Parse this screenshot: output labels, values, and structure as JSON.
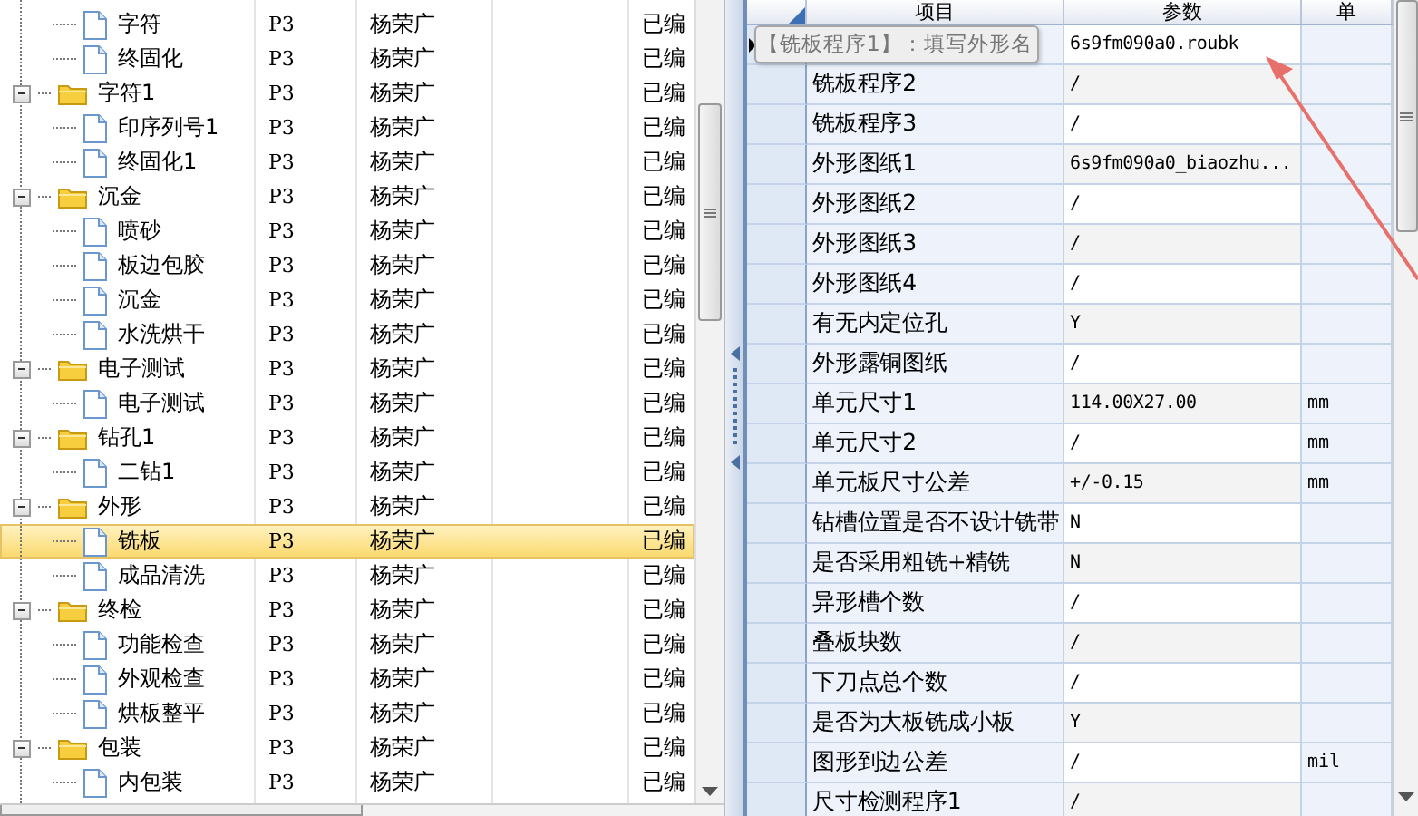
{
  "tree": [
    {
      "children": [
        {
          "kind": "file",
          "label": "字符",
          "ver": "P3",
          "person": "杨荣广",
          "status": "已编",
          "selected": false
        },
        {
          "kind": "file",
          "label": "终固化",
          "ver": "P3",
          "person": "杨荣广",
          "status": "已编",
          "selected": false
        }
      ]
    },
    {
      "kind": "folder",
      "label": "字符1",
      "ver": "P3",
      "person": "杨荣广",
      "status": "已编",
      "selected": false,
      "expanded": true,
      "children": [
        {
          "kind": "file",
          "label": "印序列号1",
          "ver": "P3",
          "person": "杨荣广",
          "status": "已编",
          "selected": false
        },
        {
          "kind": "file",
          "label": "终固化1",
          "ver": "P3",
          "person": "杨荣广",
          "status": "已编",
          "selected": false
        }
      ]
    },
    {
      "kind": "folder",
      "label": "沉金",
      "ver": "P3",
      "person": "杨荣广",
      "status": "已编",
      "selected": false,
      "expanded": true,
      "children": [
        {
          "kind": "file",
          "label": "喷砂",
          "ver": "P3",
          "person": "杨荣广",
          "status": "已编",
          "selected": false
        },
        {
          "kind": "file",
          "label": "板边包胶",
          "ver": "P3",
          "person": "杨荣广",
          "status": "已编",
          "selected": false
        },
        {
          "kind": "file",
          "label": "沉金",
          "ver": "P3",
          "person": "杨荣广",
          "status": "已编",
          "selected": false
        },
        {
          "kind": "file",
          "label": "水洗烘干",
          "ver": "P3",
          "person": "杨荣广",
          "status": "已编",
          "selected": false
        }
      ]
    },
    {
      "kind": "folder",
      "label": "电子测试",
      "ver": "P3",
      "person": "杨荣广",
      "status": "已编",
      "selected": false,
      "expanded": true,
      "children": [
        {
          "kind": "file",
          "label": "电子测试",
          "ver": "P3",
          "person": "杨荣广",
          "status": "已编",
          "selected": false
        }
      ]
    },
    {
      "kind": "folder",
      "label": "钻孔1",
      "ver": "P3",
      "person": "杨荣广",
      "status": "已编",
      "selected": false,
      "expanded": true,
      "children": [
        {
          "kind": "file",
          "label": "二钻1",
          "ver": "P3",
          "person": "杨荣广",
          "status": "已编",
          "selected": false
        }
      ]
    },
    {
      "kind": "folder",
      "label": "外形",
      "ver": "P3",
      "person": "杨荣广",
      "status": "已编",
      "selected": false,
      "expanded": true,
      "children": [
        {
          "kind": "file",
          "label": "铣板",
          "ver": "P3",
          "person": "杨荣广",
          "status": "已编",
          "selected": true
        },
        {
          "kind": "file",
          "label": "成品清洗",
          "ver": "P3",
          "person": "杨荣广",
          "status": "已编",
          "selected": false
        }
      ]
    },
    {
      "kind": "folder",
      "label": "终检",
      "ver": "P3",
      "person": "杨荣广",
      "status": "已编",
      "selected": false,
      "expanded": true,
      "children": [
        {
          "kind": "file",
          "label": "功能检查",
          "ver": "P3",
          "person": "杨荣广",
          "status": "已编",
          "selected": false
        },
        {
          "kind": "file",
          "label": "外观检查",
          "ver": "P3",
          "person": "杨荣广",
          "status": "已编",
          "selected": false
        },
        {
          "kind": "file",
          "label": "烘板整平",
          "ver": "P3",
          "person": "杨荣广",
          "status": "已编",
          "selected": false
        }
      ]
    },
    {
      "kind": "folder",
      "label": "包装",
      "ver": "P3",
      "person": "杨荣广",
      "status": "已编",
      "selected": false,
      "expanded": true,
      "children": [
        {
          "kind": "file",
          "label": "内包装",
          "ver": "P3",
          "person": "杨荣广",
          "status": "已编",
          "selected": false
        }
      ]
    }
  ],
  "grid": {
    "columns": [
      "项目",
      "参数",
      "单"
    ],
    "tooltip": "【铣板程序1】：填写外形名",
    "rows": [
      {
        "value": "6s9fm090a0.roubk",
        "selected": true
      },
      {
        "item": "铣板程序2",
        "value": "/",
        "selected": false
      },
      {
        "item": "铣板程序3",
        "value": "/",
        "selected": false
      },
      {
        "item": "外形图纸1",
        "value": "6s9fm090a0_biaozhu...",
        "selected": false
      },
      {
        "item": "外形图纸2",
        "value": "/",
        "selected": false
      },
      {
        "item": "外形图纸3",
        "value": "/",
        "selected": false
      },
      {
        "item": "外形图纸4",
        "value": "/",
        "selected": false
      },
      {
        "item": "有无内定位孔",
        "value": "Y",
        "selected": false
      },
      {
        "item": "外形露铜图纸",
        "value": "/",
        "selected": false
      },
      {
        "item": "单元尺寸1",
        "value": "114.00X27.00",
        "unit": "mm",
        "selected": false
      },
      {
        "item": "单元尺寸2",
        "value": "/",
        "unit": "mm",
        "selected": false
      },
      {
        "item": "单元板尺寸公差",
        "value": "+/-0.15",
        "unit": "mm",
        "selected": false
      },
      {
        "item": "钻槽位置是否不设计铣带",
        "value": "N",
        "selected": false
      },
      {
        "item": "是否采用粗铣+精铣",
        "value": "N",
        "selected": false
      },
      {
        "item": "异形槽个数",
        "value": "/",
        "selected": false
      },
      {
        "item": "叠板块数",
        "value": "/",
        "selected": false
      },
      {
        "item": "下刀点总个数",
        "value": "/",
        "selected": false
      },
      {
        "item": "是否为大板铣成小板",
        "value": "Y",
        "selected": false
      },
      {
        "item": "图形到边公差",
        "value": "/",
        "unit": "mil",
        "selected": false
      },
      {
        "item": "尺寸检测程序1",
        "value": "/",
        "selected": false
      }
    ]
  }
}
